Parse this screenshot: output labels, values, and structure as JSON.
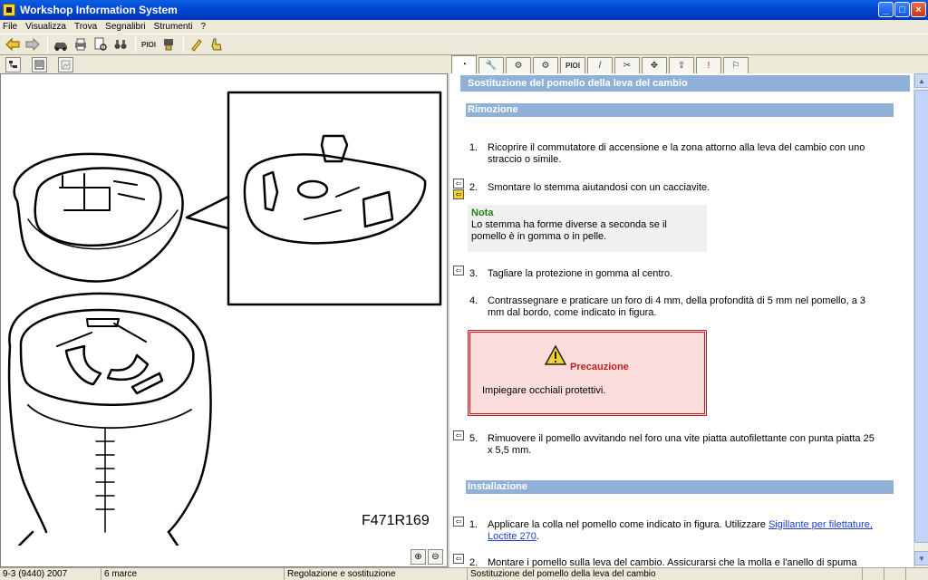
{
  "window": {
    "title": "Workshop Information System"
  },
  "menu": [
    "File",
    "Visualizza",
    "Trova",
    "Segnalibri",
    "Strumenti",
    "?"
  ],
  "toolbar": {
    "pioi_label": "PIOI"
  },
  "right_tabs": {
    "pioi_label": "PIOI"
  },
  "figure": {
    "code": "F471R169"
  },
  "document": {
    "title": "Sostituzione del pomello della leva del cambio",
    "sections": {
      "removal": {
        "header": "Rimozione",
        "steps": [
          {
            "num": "1.",
            "text": "Ricoprire il commutatore di accensione e la zona attorno alla leva del cambio con uno straccio o simile."
          },
          {
            "num": "2.",
            "text": "Smontare lo stemma aiutandosi con un cacciavite."
          },
          {
            "num": "3.",
            "text": "Tagliare la protezione in gomma al centro."
          },
          {
            "num": "4.",
            "text": "Contrassegnare e praticare un foro di 4 mm, della profondità di 5 mm nel pomello, a 3 mm dal bordo, come indicato in figura."
          },
          {
            "num": "5.",
            "text": "Rimuovere il pomello avvitando nel foro una vite piatta autofilettante con punta piatta 25 x 5,5 mm."
          }
        ],
        "note": {
          "title": "Nota",
          "text": "Lo stemma ha forme diverse a seconda se il pomello è in gomma o in pelle."
        },
        "caution": {
          "title": "Precauzione",
          "text": "Impiegare occhiali protettivi."
        }
      },
      "installation": {
        "header": "Installazione",
        "steps": [
          {
            "num": "1.",
            "text_before": "Applicare la colla nel pomello come indicato in figura. Utilizzare ",
            "link": "Sigillante per filettature, Loctite 270",
            "text_after": "."
          },
          {
            "num": "2.",
            "text": "Montare i pomello sulla leva del cambio. Assicurarsi che la molla e l'anello di spuma"
          }
        ]
      }
    }
  },
  "status": [
    "9-3 (9440) 2007",
    "6 marce",
    "Regolazione e sostituzione",
    "Sostituzione del pomello della leva del cambio"
  ]
}
